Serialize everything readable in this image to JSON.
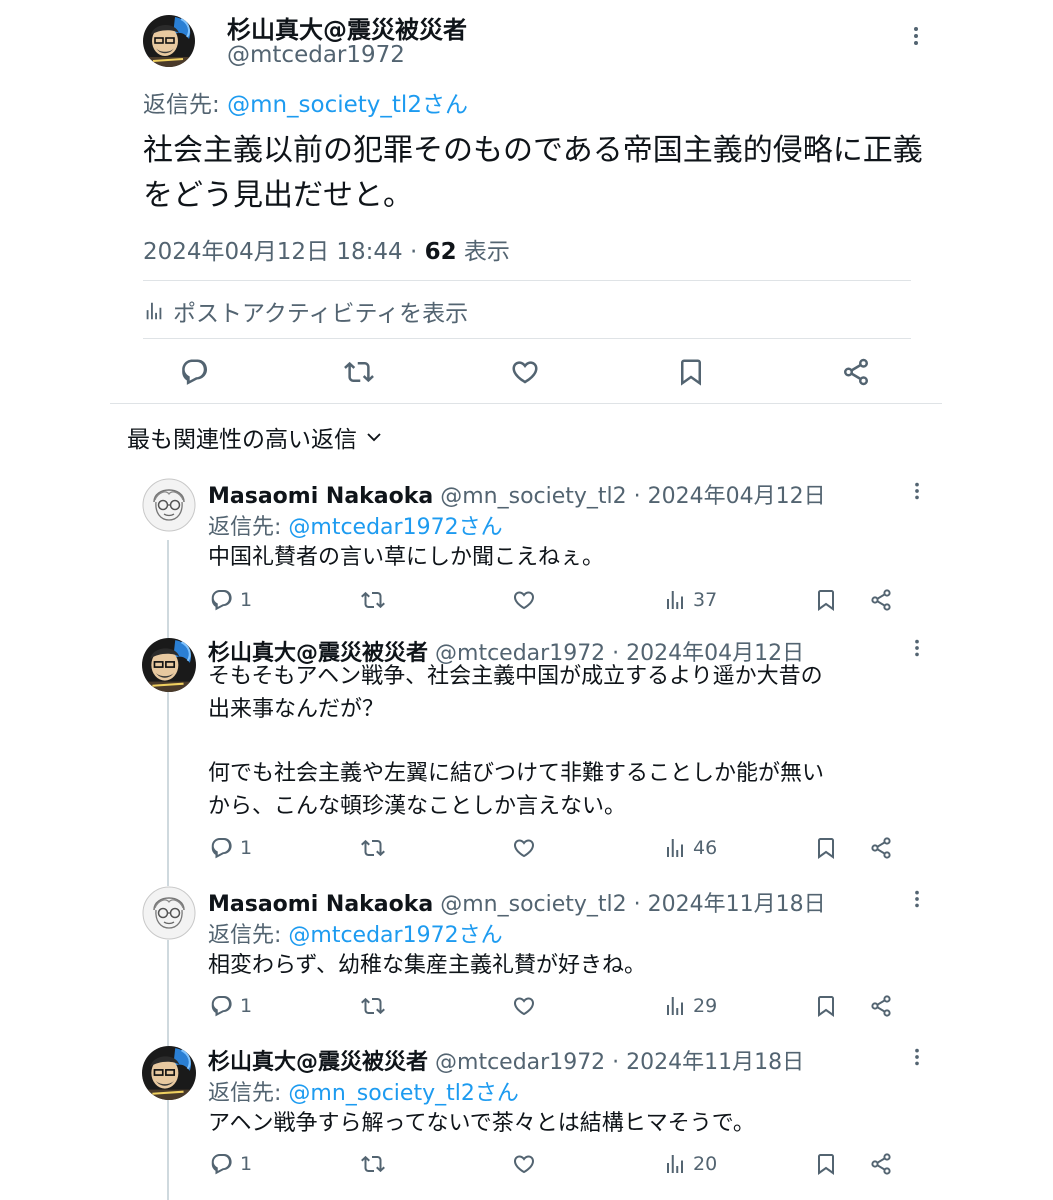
{
  "main": {
    "author_name": "杉山真大@震災被災者",
    "author_handle": "@mtcedar1972",
    "reply_prefix": "返信先: ",
    "reply_to": "@mn_society_tl2さん",
    "text": "社会主義以前の犯罪そのものである帝国主義的侵略に正義をどう見出だせと。",
    "timestamp": "2024年04月12日 18:44",
    "separator": " · ",
    "views_count": "62",
    "views_label": " 表示",
    "activity_label": "ポストアクティビティを表示"
  },
  "sort_label": "最も関連性の高い返信",
  "replies": [
    {
      "name": "Masaomi Nakaoka",
      "handle": "@mn_society_tl2",
      "date": "2024年04月12日",
      "reply_prefix": "返信先: ",
      "reply_to": "@mtcedar1972さん",
      "text": "中国礼賛者の言い草にしか聞こえねぇ。",
      "replies_count": "1",
      "views_count": "37"
    },
    {
      "name": "杉山真大@震災被災者",
      "handle": "@mtcedar1972",
      "date": "2024年04月12日",
      "text_line1": "そもそもアヘン戦争、社会主義中国が成立するより遥か大昔の",
      "text_line2": "出来事なんだが？",
      "text_line3": "何でも社会主義や左翼に結びつけて非難することしか能が無い",
      "text_line4": "から、こんな頓珍漢なことしか言えない。",
      "replies_count": "1",
      "views_count": "46"
    },
    {
      "name": "Masaomi Nakaoka",
      "handle": "@mn_society_tl2",
      "date": "2024年11月18日",
      "reply_prefix": "返信先: ",
      "reply_to": "@mtcedar1972さん",
      "text": "相変わらず、幼稚な集産主義礼賛が好きね。",
      "replies_count": "1",
      "views_count": "29"
    },
    {
      "name": "杉山真大@震災被災者",
      "handle": "@mtcedar1972",
      "date": "2024年11月18日",
      "reply_prefix": "返信先: ",
      "reply_to": "@mn_society_tl2さん",
      "text": "アヘン戦争すら解ってないで茶々とは結構ヒマそうで。",
      "replies_count": "1",
      "views_count": "20"
    }
  ],
  "colors": {
    "accent": "#1d9bf0",
    "secondary_text": "#536471",
    "text": "#0f1419",
    "divider": "#dfe3e6"
  }
}
